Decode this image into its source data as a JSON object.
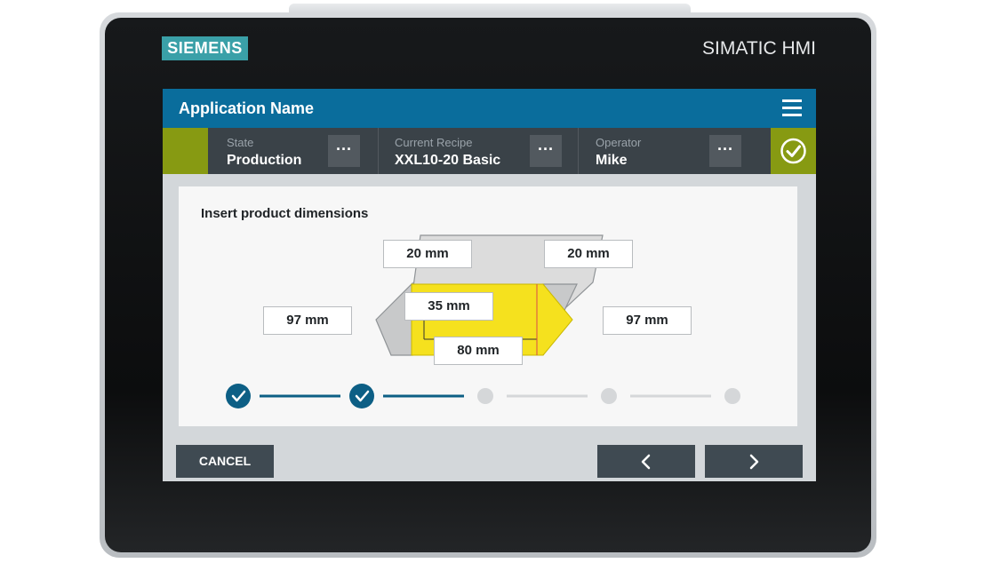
{
  "device": {
    "brand": "SIEMENS",
    "model_label": "SIMATIC HMI"
  },
  "app": {
    "title": "Application Name",
    "menu_icon": "hamburger-menu-icon"
  },
  "status_bar": {
    "state": {
      "caption": "State",
      "value": "Production"
    },
    "recipe": {
      "caption": "Current Recipe",
      "value": "XXL10-20 Basic"
    },
    "operator": {
      "caption": "Operator",
      "value": "Mike"
    },
    "more_label": "···",
    "status_icon": "check-circle-icon"
  },
  "content": {
    "heading": "Insert product dimensions",
    "dimensions": {
      "top_left": "20 mm",
      "top_right": "20 mm",
      "left": "97 mm",
      "right": "97 mm",
      "height": "35 mm",
      "width": "80 mm"
    },
    "wizard": {
      "total_steps": 5,
      "completed_steps": 2
    }
  },
  "footer": {
    "cancel_label": "CANCEL",
    "prev_icon": "chevron-left-icon",
    "next_icon": "chevron-right-icon"
  },
  "colors": {
    "header_blue": "#0a6d9c",
    "status_green": "#879a12",
    "brand_teal": "#3aa0a8",
    "product_yellow": "#f5e11e",
    "step_done": "#0d5f85",
    "button_dark": "#3f4a52"
  }
}
